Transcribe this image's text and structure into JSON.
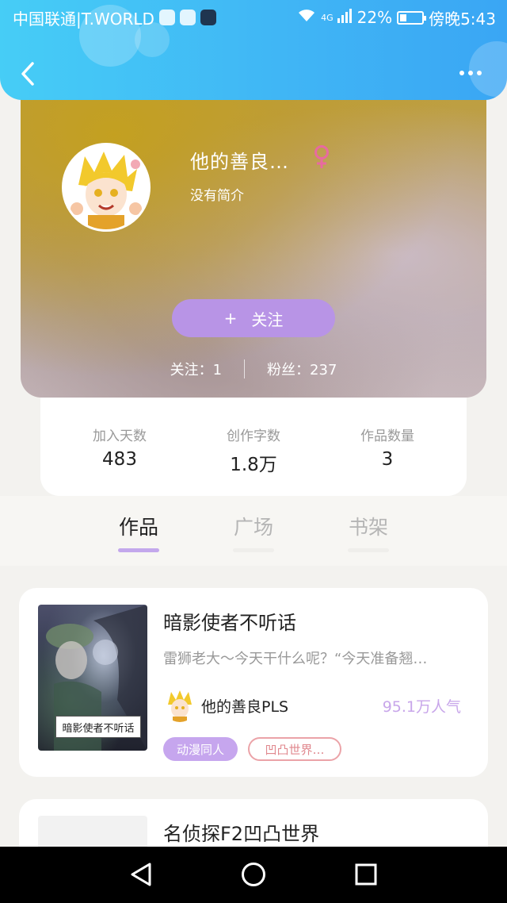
{
  "status_bar": {
    "carrier": "中国联通|T.WORLD",
    "network": "4G",
    "battery": "22%",
    "time": "傍晚5:43"
  },
  "profile": {
    "nickname": "他的善良…",
    "gender_symbol": "♀",
    "bio": "没有简介",
    "follow_plus": "+",
    "follow_label": "关注",
    "following": "关注：1",
    "fans": "粉丝：237"
  },
  "stats": [
    {
      "label": "加入天数",
      "value": "483"
    },
    {
      "label": "创作字数",
      "value": "1.8万"
    },
    {
      "label": "作品数量",
      "value": "3"
    }
  ],
  "tabs": [
    {
      "label": "作品",
      "active": true
    },
    {
      "label": "广场",
      "active": false
    },
    {
      "label": "书架",
      "active": false
    }
  ],
  "works": [
    {
      "title": "暗影使者不听话",
      "cover_title": "暗影使者不听话",
      "description": "雷狮老大～今天干什么呢？“今天准备翘…",
      "author": "他的善良PLS",
      "popularity": "95.1万人气",
      "tags": [
        "动漫同人",
        "凹凸世界…"
      ]
    },
    {
      "title": "名侦探F2凹凸世界"
    }
  ],
  "colors": {
    "header_gradient_start": "#46cdf6",
    "header_gradient_end": "#3aa6f4",
    "accent_purple": "#b894e6",
    "popularity_color": "#c8a6ea",
    "gender_color": "#e86aa0",
    "tag_outline": "#eba3a8"
  }
}
